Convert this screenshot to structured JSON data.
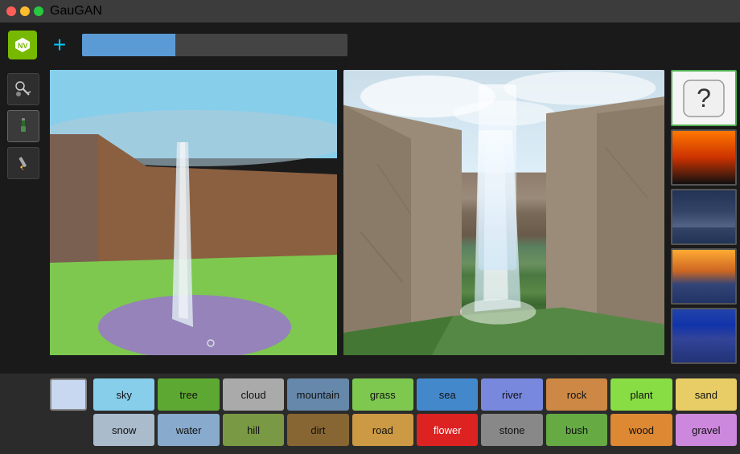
{
  "app": {
    "title": "GauGAN"
  },
  "toolbar": {
    "plus_label": "+",
    "progress_value": 35
  },
  "tools": [
    {
      "id": "eyedropper",
      "label": "eyedropper",
      "icon": "💧"
    },
    {
      "id": "brush",
      "label": "brush",
      "icon": "🖌"
    },
    {
      "id": "pencil",
      "label": "pencil",
      "icon": "✏"
    }
  ],
  "labels_row1": [
    {
      "id": "sky",
      "label": "sky",
      "color_class": "c-sky"
    },
    {
      "id": "tree",
      "label": "tree",
      "color_class": "c-tree"
    },
    {
      "id": "cloud",
      "label": "cloud",
      "color_class": "c-cloud"
    },
    {
      "id": "mountain",
      "label": "mountain",
      "color_class": "c-mountain"
    },
    {
      "id": "grass",
      "label": "grass",
      "color_class": "c-grass"
    },
    {
      "id": "sea",
      "label": "sea",
      "color_class": "c-sea"
    },
    {
      "id": "river",
      "label": "river",
      "color_class": "c-river"
    },
    {
      "id": "rock",
      "label": "rock",
      "color_class": "c-rock"
    },
    {
      "id": "plant",
      "label": "plant",
      "color_class": "c-plant"
    },
    {
      "id": "sand",
      "label": "sand",
      "color_class": "c-sand"
    }
  ],
  "labels_row2": [
    {
      "id": "snow",
      "label": "snow",
      "color_class": "c-snow"
    },
    {
      "id": "water",
      "label": "water",
      "color_class": "c-water"
    },
    {
      "id": "hill",
      "label": "hill",
      "color_class": "c-hill"
    },
    {
      "id": "dirt",
      "label": "dirt",
      "color_class": "c-dirt"
    },
    {
      "id": "road",
      "label": "road",
      "color_class": "c-road"
    },
    {
      "id": "flower",
      "label": "flower",
      "color_class": "c-flower"
    },
    {
      "id": "stone",
      "label": "stone",
      "color_class": "c-stone"
    },
    {
      "id": "bush",
      "label": "bush",
      "color_class": "c-bush"
    },
    {
      "id": "wood",
      "label": "wood",
      "color_class": "c-wood"
    },
    {
      "id": "gravel",
      "label": "gravel",
      "color_class": "c-gravel"
    }
  ],
  "results": [
    {
      "id": "dice",
      "type": "dice",
      "label": "random"
    },
    {
      "id": "thumb1",
      "type": "thumb-1",
      "label": "result 1"
    },
    {
      "id": "thumb2",
      "type": "thumb-2",
      "label": "result 2"
    },
    {
      "id": "thumb3",
      "type": "thumb-3",
      "label": "result 3"
    },
    {
      "id": "thumb4",
      "type": "thumb-4",
      "label": "result 4"
    }
  ]
}
